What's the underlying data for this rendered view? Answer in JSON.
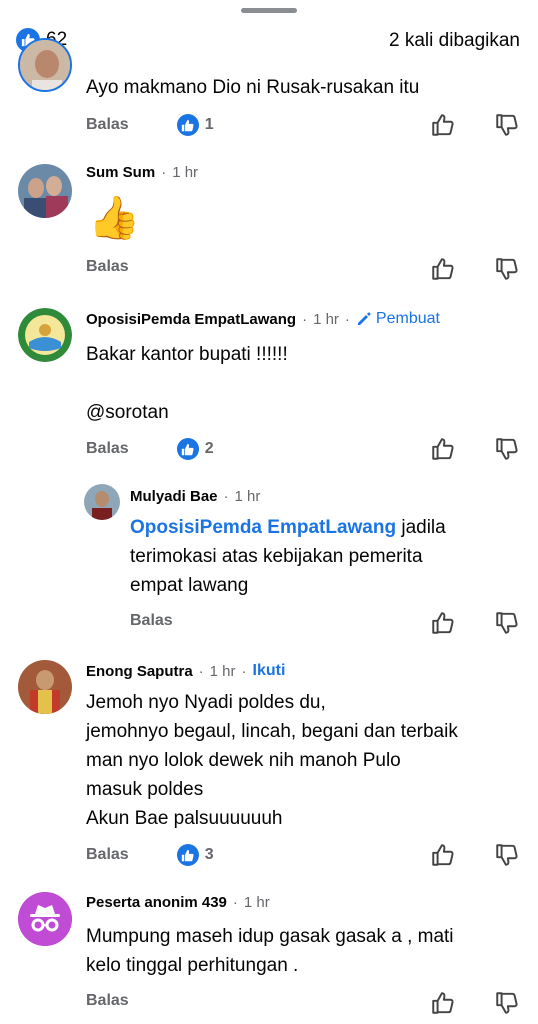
{
  "header": {
    "like_count": "62",
    "shares": "2 kali dibagikan"
  },
  "reply_label": "Balas",
  "comments": [
    {
      "text": [
        "Ayo makmano Dio ni Rusak-rusakan itu"
      ],
      "reactions": "1"
    },
    {
      "name": "Sum Sum",
      "time": "1 hr",
      "emoji": "👍"
    },
    {
      "name": "OposisiPemda EmpatLawang",
      "time": "1 hr",
      "badge": "Pembuat",
      "text": [
        "Bakar kantor bupati !!!!!!",
        "",
        "@sorotan"
      ],
      "reactions": "2"
    },
    {
      "name": "Mulyadi Bae",
      "time": "1 hr",
      "mention": "OposisiPemda EmpatLawang",
      "text": [
        "jadila",
        "terimokasi atas kebijakan pemerita",
        "empat lawang"
      ]
    },
    {
      "name": "Enong Saputra",
      "time": "1 hr",
      "follow": "Ikuti",
      "text": [
        "Jemoh nyo Nyadi poldes du,",
        "jemohnyo begaul, lincah, begani dan terbaik",
        "man nyo lolok dewek nih manoh Pulo",
        "masuk poldes",
        "Akun Bae palsuuuuuuh"
      ],
      "reactions": "3"
    },
    {
      "name": "Peserta anonim 439",
      "time": "1 hr",
      "text": [
        "Mumpung maseh idup gasak gasak a , mati",
        "kelo tinggal perhitungan ."
      ]
    }
  ],
  "colors": {
    "accent": "#1b74e4",
    "secondary": "#65676b",
    "anon_avatar": "#c04cd6"
  }
}
